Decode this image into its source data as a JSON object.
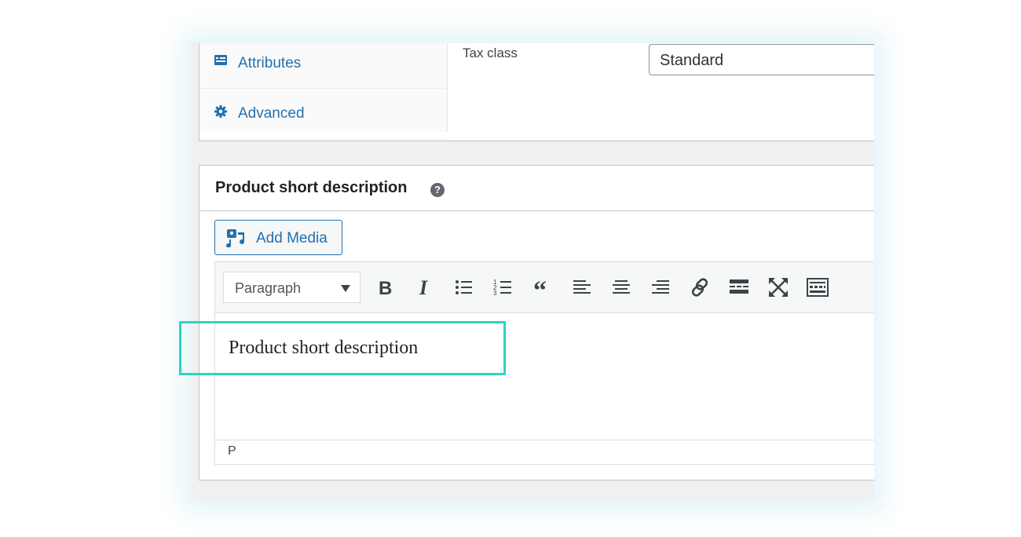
{
  "tabs": [
    {
      "label": "Attributes",
      "icon": "list-icon"
    },
    {
      "label": "Advanced",
      "icon": "gear-icon"
    }
  ],
  "tax": {
    "label": "Tax class",
    "value": "Standard"
  },
  "short_description": {
    "title": "Product short description",
    "help_icon": "question-icon",
    "add_media_label": "Add Media",
    "format_select": "Paragraph",
    "toolbar_icons": [
      "bold-icon",
      "italic-icon",
      "bullet-list-icon",
      "numbered-list-icon",
      "blockquote-icon",
      "align-left-icon",
      "align-center-icon",
      "align-right-icon",
      "link-icon",
      "read-more-icon",
      "fullscreen-icon",
      "toolbar-toggle-icon"
    ],
    "content": "Product short description",
    "status_path": "P"
  },
  "colors": {
    "accent": "#2271b1",
    "highlight": "#2dd4c3"
  }
}
